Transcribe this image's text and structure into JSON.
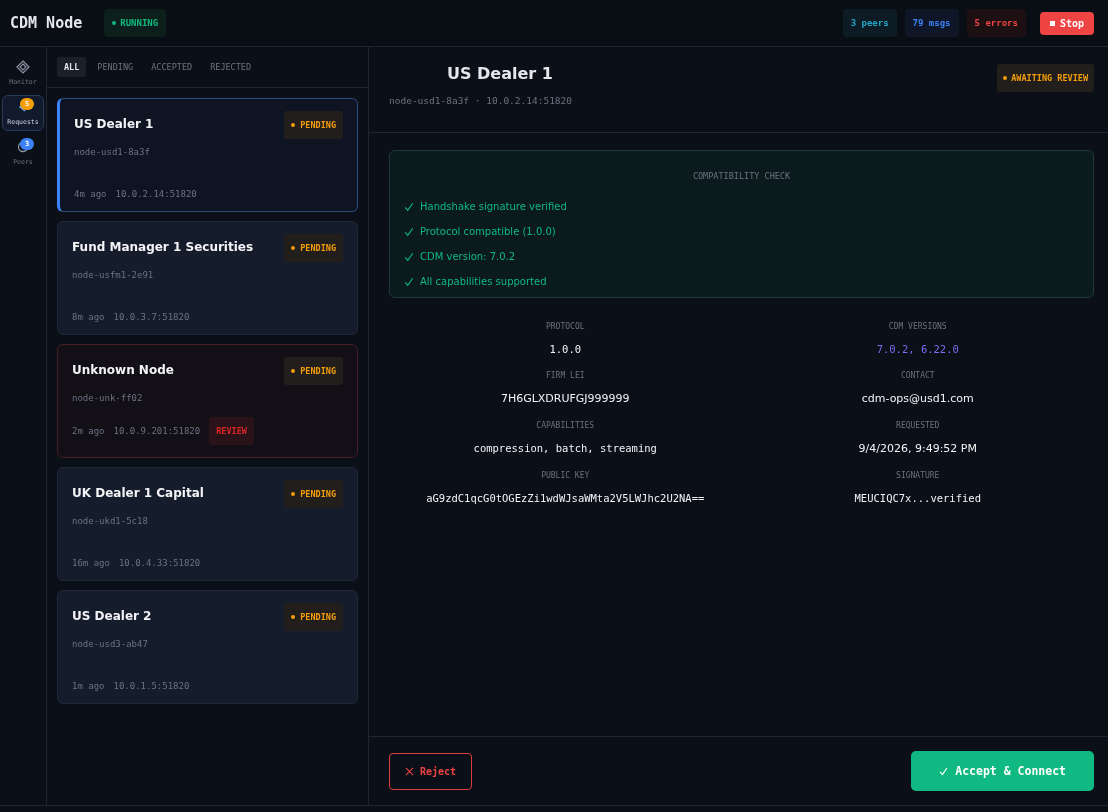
{
  "header": {
    "title": "CDM Node",
    "status": {
      "label": "RUNNING",
      "kind": "running"
    },
    "stats": [
      {
        "label": "3 peers",
        "kind": "peers"
      },
      {
        "label": "79 msgs",
        "kind": "msgs"
      },
      {
        "label": "5 errors",
        "kind": "errors"
      }
    ],
    "stop_button": "Stop"
  },
  "sidebar": {
    "items": [
      {
        "label": "Monitor",
        "kind": "monitor",
        "selected": false
      },
      {
        "label": "Requests",
        "kind": "requests",
        "badge": "5",
        "color": "#f59e0b",
        "selected": true
      },
      {
        "label": "Peers",
        "kind": "peers",
        "badge": "3",
        "color": "#3b82f6",
        "selected": false
      }
    ]
  },
  "filter_tabs": [
    {
      "label": "ALL",
      "selected": true
    },
    {
      "label": "PENDING",
      "selected": false
    },
    {
      "label": "ACCEPTED",
      "selected": false
    },
    {
      "label": "REJECTED",
      "selected": false
    }
  ],
  "requests": [
    {
      "name": "US Dealer 1",
      "node_id": "node-usd1-8a3f",
      "age": "4m ago",
      "address": "10.0.2.14:51820",
      "status": "PENDING",
      "selected": true,
      "flagged": false
    },
    {
      "name": "Fund Manager 1 Securities",
      "node_id": "node-usfm1-2e91",
      "age": "8m ago",
      "address": "10.0.3.7:51820",
      "status": "PENDING",
      "selected": false,
      "flagged": false
    },
    {
      "name": "Unknown Node",
      "node_id": "node-unk-ff02",
      "age": "2m ago",
      "address": "10.0.9.201:51820",
      "status": "PENDING",
      "selected": false,
      "flagged": true,
      "flag_label": "REVIEW"
    },
    {
      "name": "UK Dealer 1 Capital",
      "node_id": "node-ukd1-5c18",
      "age": "16m ago",
      "address": "10.0.4.33:51820",
      "status": "PENDING",
      "selected": false,
      "flagged": false
    },
    {
      "name": "US Dealer 2",
      "node_id": "node-usd3-ab47",
      "age": "1m ago",
      "address": "10.0.1.5:51820",
      "status": "PENDING",
      "selected": false,
      "flagged": false
    }
  ],
  "detail": {
    "name": "US Dealer 1",
    "subtitle": "node-usd1-8a3f · 10.0.2.14:51820",
    "status": "AWAITING REVIEW",
    "check": {
      "title": "COMPATIBILITY CHECK",
      "items": [
        {
          "label": "Handshake signature verified",
          "passed": true
        },
        {
          "label": "Protocol compatible (1.0.0)",
          "passed": true
        },
        {
          "label": "CDM version: 7.0.2",
          "passed": true
        },
        {
          "label": "All capabilities supported",
          "passed": true
        }
      ]
    },
    "fields": [
      {
        "label": "PROTOCOL",
        "value": "1.0.0",
        "kind": "mono"
      },
      {
        "label": "CDM VERSIONS",
        "value": "7.0.2, 6.22.0",
        "kind": "accent"
      },
      {
        "label": "FIRM LEI",
        "value": "7H6GLXDRUFGJ999999",
        "kind": "plain"
      },
      {
        "label": "CONTACT",
        "value": "cdm-ops@usd1.com",
        "kind": "plain"
      },
      {
        "label": "CAPABILITIES",
        "value": "compression, batch, streaming",
        "kind": "mono"
      },
      {
        "label": "REQUESTED",
        "value": "9/4/2026, 9:49:52 PM",
        "kind": "plain"
      },
      {
        "label": "PUBLIC KEY",
        "value": "aG9zdC1qcG0tOGEzZi1wdWJsaWMta2V5LWJhc2U2NA==",
        "kind": "mono"
      },
      {
        "label": "SIGNATURE",
        "value": "MEUCIQC7x...verified",
        "kind": "mono"
      }
    ],
    "reject_button": "Reject",
    "accept_button": "Accept & Connect"
  }
}
